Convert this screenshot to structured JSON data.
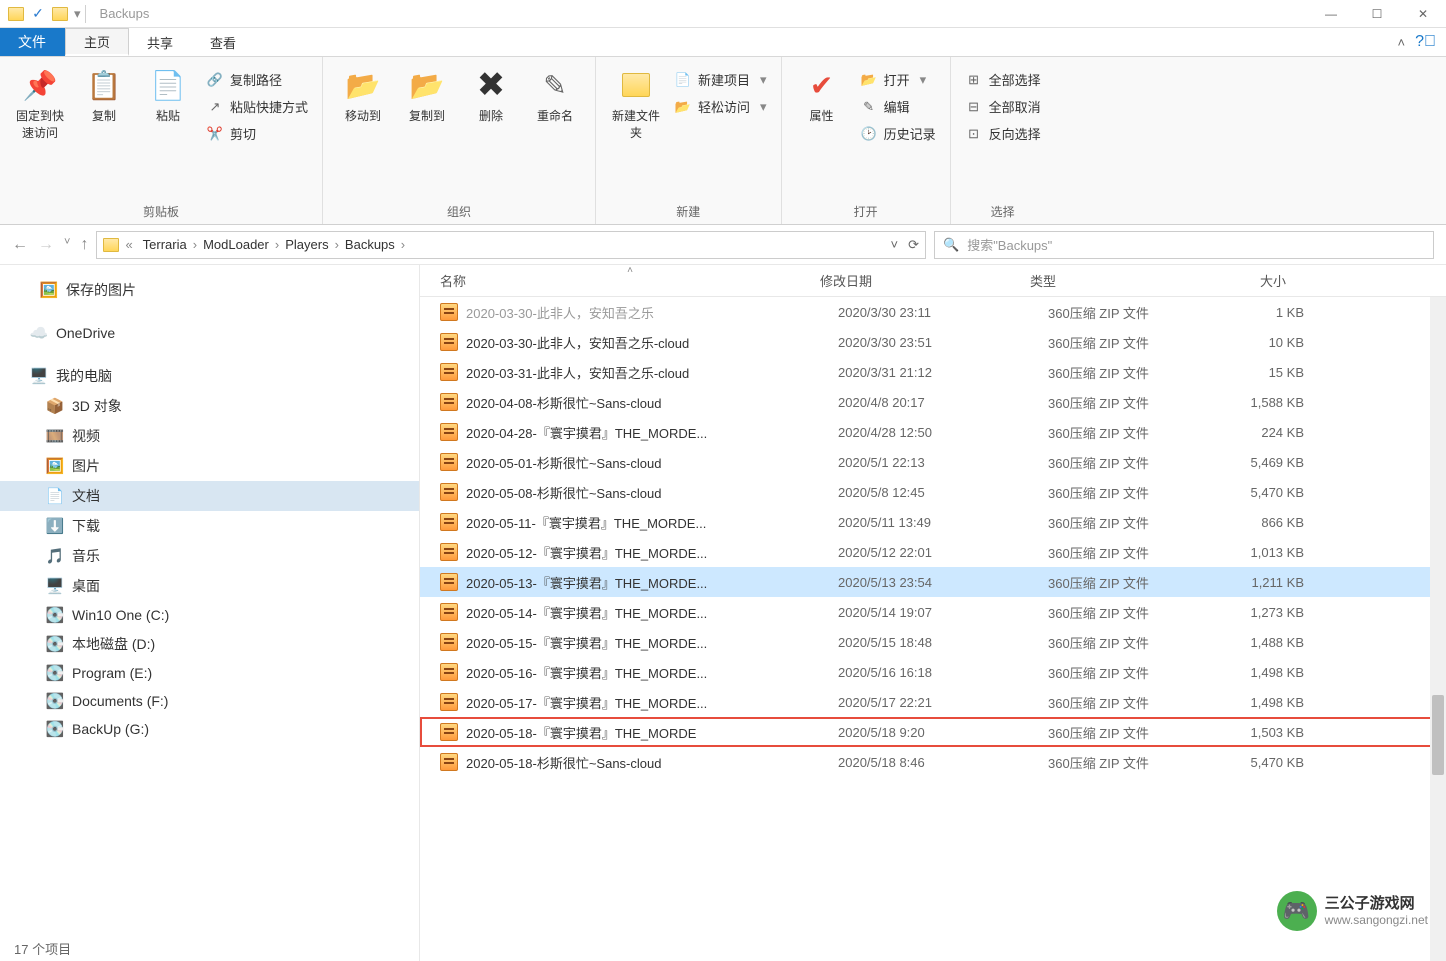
{
  "window": {
    "title": "Backups"
  },
  "tabs": {
    "file": "文件",
    "home": "主页",
    "share": "共享",
    "view": "查看"
  },
  "ribbon": {
    "clipboard": {
      "pin": "固定到快速访问",
      "copy": "复制",
      "paste": "粘贴",
      "copy_path": "复制路径",
      "paste_shortcut": "粘贴快捷方式",
      "cut": "剪切",
      "label": "剪贴板"
    },
    "organize": {
      "move_to": "移动到",
      "copy_to": "复制到",
      "delete": "删除",
      "rename": "重命名",
      "label": "组织"
    },
    "new": {
      "new_folder": "新建文件夹",
      "new_item": "新建项目",
      "easy_access": "轻松访问",
      "label": "新建"
    },
    "open": {
      "properties": "属性",
      "open": "打开",
      "edit": "编辑",
      "history": "历史记录",
      "label": "打开"
    },
    "select": {
      "select_all": "全部选择",
      "select_none": "全部取消",
      "invert": "反向选择",
      "label": "选择"
    }
  },
  "breadcrumb": {
    "prefix": "«",
    "parts": [
      "Terraria",
      "ModLoader",
      "Players",
      "Backups"
    ]
  },
  "search": {
    "placeholder": "搜索\"Backups\""
  },
  "tree": {
    "items": [
      {
        "icon": "🖼️",
        "label": "保存的图片",
        "indent": 40
      },
      {
        "spacer": true
      },
      {
        "icon": "☁️",
        "label": "OneDrive",
        "indent": 30,
        "color": "#1979ca"
      },
      {
        "spacer": true
      },
      {
        "icon": "🖥️",
        "label": "我的电脑",
        "indent": 30,
        "color": "#1979ca"
      },
      {
        "icon": "📦",
        "label": "3D 对象",
        "indent": 46
      },
      {
        "icon": "🎞️",
        "label": "视频",
        "indent": 46
      },
      {
        "icon": "🖼️",
        "label": "图片",
        "indent": 46
      },
      {
        "icon": "📄",
        "label": "文档",
        "indent": 46,
        "selected": true
      },
      {
        "icon": "⬇️",
        "label": "下载",
        "indent": 46,
        "color": "#1979ca"
      },
      {
        "icon": "🎵",
        "label": "音乐",
        "indent": 46,
        "color": "#1979ca"
      },
      {
        "icon": "🖥️",
        "label": "桌面",
        "indent": 46,
        "color": "#1979ca"
      },
      {
        "icon": "💽",
        "label": "Win10 One (C:)",
        "indent": 46
      },
      {
        "icon": "💽",
        "label": "本地磁盘 (D:)",
        "indent": 46
      },
      {
        "icon": "💽",
        "label": "Program (E:)",
        "indent": 46
      },
      {
        "icon": "💽",
        "label": "Documents (F:)",
        "indent": 46
      },
      {
        "icon": "💽",
        "label": "BackUp (G:)",
        "indent": 46
      }
    ]
  },
  "columns": {
    "name": "名称",
    "date": "修改日期",
    "type": "类型",
    "size": "大小"
  },
  "files": [
    {
      "name": "2020-03-30-此非人，安知吾之乐",
      "date": "2020/3/30 23:11",
      "type": "360压缩 ZIP 文件",
      "size": "1 KB",
      "cut": true
    },
    {
      "name": "2020-03-30-此非人，安知吾之乐-cloud",
      "date": "2020/3/30 23:51",
      "type": "360压缩 ZIP 文件",
      "size": "10 KB"
    },
    {
      "name": "2020-03-31-此非人，安知吾之乐-cloud",
      "date": "2020/3/31 21:12",
      "type": "360压缩 ZIP 文件",
      "size": "15 KB"
    },
    {
      "name": "2020-04-08-杉斯很忙~Sans-cloud",
      "date": "2020/4/8 20:17",
      "type": "360压缩 ZIP 文件",
      "size": "1,588 KB"
    },
    {
      "name": "2020-04-28-『寰宇摸君』THE_MORDE...",
      "date": "2020/4/28 12:50",
      "type": "360压缩 ZIP 文件",
      "size": "224 KB"
    },
    {
      "name": "2020-05-01-杉斯很忙~Sans-cloud",
      "date": "2020/5/1 22:13",
      "type": "360压缩 ZIP 文件",
      "size": "5,469 KB"
    },
    {
      "name": "2020-05-08-杉斯很忙~Sans-cloud",
      "date": "2020/5/8 12:45",
      "type": "360压缩 ZIP 文件",
      "size": "5,470 KB"
    },
    {
      "name": "2020-05-11-『寰宇摸君』THE_MORDE...",
      "date": "2020/5/11 13:49",
      "type": "360压缩 ZIP 文件",
      "size": "866 KB"
    },
    {
      "name": "2020-05-12-『寰宇摸君』THE_MORDE...",
      "date": "2020/5/12 22:01",
      "type": "360压缩 ZIP 文件",
      "size": "1,013 KB"
    },
    {
      "name": "2020-05-13-『寰宇摸君』THE_MORDE...",
      "date": "2020/5/13 23:54",
      "type": "360压缩 ZIP 文件",
      "size": "1,211 KB",
      "selected": true
    },
    {
      "name": "2020-05-14-『寰宇摸君』THE_MORDE...",
      "date": "2020/5/14 19:07",
      "type": "360压缩 ZIP 文件",
      "size": "1,273 KB"
    },
    {
      "name": "2020-05-15-『寰宇摸君』THE_MORDE...",
      "date": "2020/5/15 18:48",
      "type": "360压缩 ZIP 文件",
      "size": "1,488 KB"
    },
    {
      "name": "2020-05-16-『寰宇摸君』THE_MORDE...",
      "date": "2020/5/16 16:18",
      "type": "360压缩 ZIP 文件",
      "size": "1,498 KB"
    },
    {
      "name": "2020-05-17-『寰宇摸君』THE_MORDE...",
      "date": "2020/5/17 22:21",
      "type": "360压缩 ZIP 文件",
      "size": "1,498 KB"
    },
    {
      "name": "2020-05-18-『寰宇摸君』THE_MORDE",
      "date": "2020/5/18 9:20",
      "type": "360压缩 ZIP 文件",
      "size": "1,503 KB",
      "highlight": true
    },
    {
      "name": "2020-05-18-杉斯很忙~Sans-cloud",
      "date": "2020/5/18 8:46",
      "type": "360压缩 ZIP 文件",
      "size": "5,470 KB"
    }
  ],
  "status": {
    "count": "17 个项目"
  },
  "watermark": {
    "name": "三公子游戏网",
    "url": "www.sangongzi.net"
  }
}
